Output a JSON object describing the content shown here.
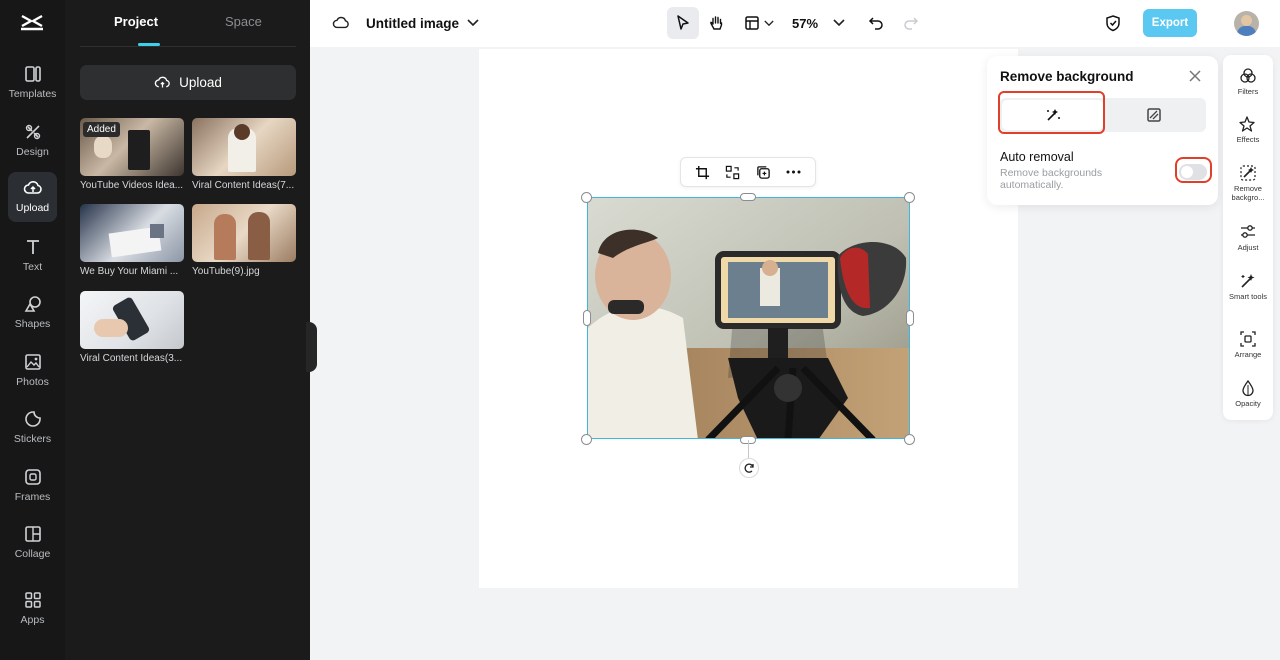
{
  "left_rail": {
    "items": [
      {
        "label": "Templates",
        "icon": "templates-icon"
      },
      {
        "label": "Design",
        "icon": "design-icon"
      },
      {
        "label": "Upload",
        "icon": "upload-cloud-icon",
        "active": true
      },
      {
        "label": "Text",
        "icon": "text-icon"
      },
      {
        "label": "Shapes",
        "icon": "shapes-icon"
      },
      {
        "label": "Photos",
        "icon": "photos-icon"
      },
      {
        "label": "Stickers",
        "icon": "stickers-icon"
      },
      {
        "label": "Frames",
        "icon": "frames-icon"
      },
      {
        "label": "Collage",
        "icon": "collage-icon"
      },
      {
        "label": "Apps",
        "icon": "apps-icon"
      }
    ]
  },
  "panel": {
    "tabs": [
      "Project",
      "Space"
    ],
    "upload_label": "Upload",
    "files": [
      {
        "name": "YouTube Videos Idea...",
        "badge": "Added"
      },
      {
        "name": "Viral Content Ideas(7..."
      },
      {
        "name": "We Buy Your Miami ..."
      },
      {
        "name": "YouTube(9).jpg"
      },
      {
        "name": "Viral Content Ideas(3..."
      }
    ]
  },
  "topbar": {
    "title": "Untitled image",
    "zoom": "57%",
    "export_label": "Export"
  },
  "remove_bg": {
    "title": "Remove background",
    "auto_removal_title": "Auto removal",
    "auto_removal_desc": "Remove backgrounds automatically.",
    "auto_removal_on": false
  },
  "right_tools": [
    {
      "label": "Filters",
      "icon": "filters-icon"
    },
    {
      "label": "Effects",
      "icon": "effects-icon"
    },
    {
      "label": "Remove backgro...",
      "icon": "remove-background-icon",
      "active": true
    },
    {
      "label": "Adjust",
      "icon": "adjust-icon"
    },
    {
      "label": "Smart tools",
      "icon": "smart-tools-icon"
    },
    {
      "label": "Arrange",
      "icon": "arrange-icon"
    },
    {
      "label": "Opacity",
      "icon": "opacity-icon"
    }
  ],
  "colors": {
    "accent": "#3ed0ea",
    "export": "#5ac8f0",
    "highlight": "#e0402a",
    "selection": "#3fb6e0"
  }
}
